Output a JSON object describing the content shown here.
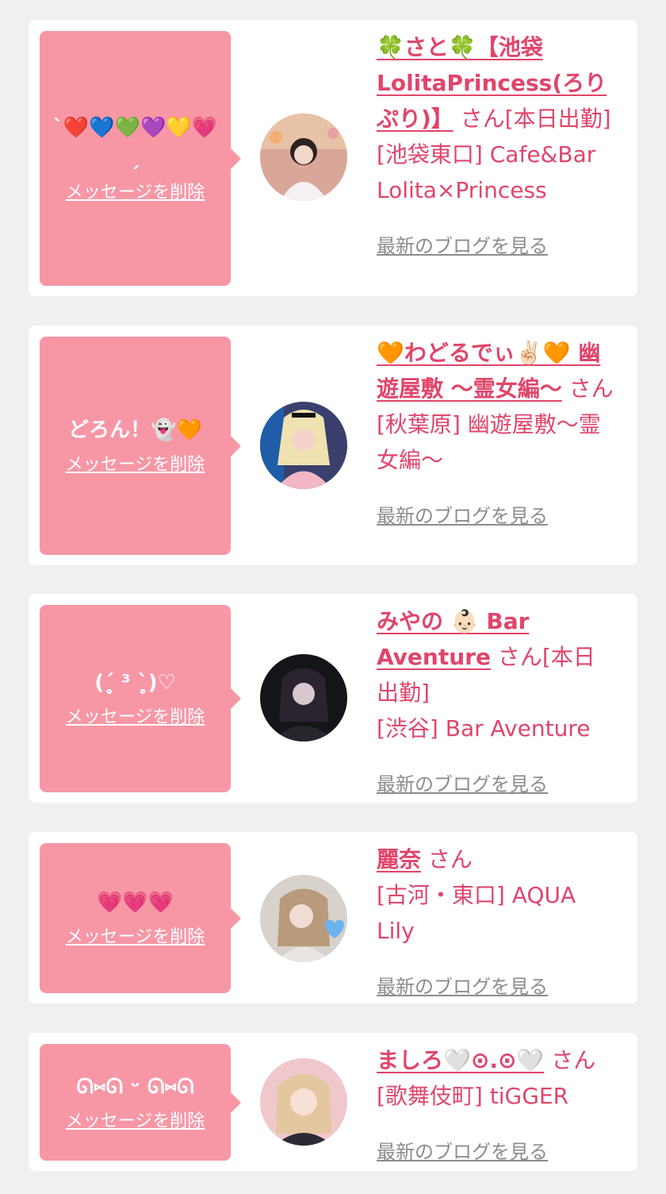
{
  "entries": [
    {
      "message": "ˋ❤️💙💚💜💛💗ˏ",
      "delete_label": "メッセージを削除",
      "name": "🍀さと🍀【池袋LolitaPrincess(ろりぷり)】",
      "suffix": "さん[本日出勤]",
      "shop": "[池袋東口] Cafe&Bar Lolita×Princess",
      "blog_label": "最新のブログを見る"
    },
    {
      "message": "どろん！👻🧡",
      "delete_label": "メッセージを削除",
      "name": "🧡わどるでぃ✌🏻🧡 幽遊屋敷 〜霊女編〜",
      "suffix": "さん",
      "shop": "[秋葉原] 幽遊屋敷〜霊女編〜",
      "blog_label": "最新のブログを見る"
    },
    {
      "message": "(ˊ̥̥̥̥̥ ³ ˋ̥̥̥̥̥)♡",
      "delete_label": "メッセージを削除",
      "name": "みやの 👶🏻 Bar Aventure",
      "suffix": "さん[本日出勤]",
      "shop": "[渋谷] Bar Aventure",
      "blog_label": "最新のブログを見る"
    },
    {
      "message": "💗💗💗",
      "delete_label": "メッセージを削除",
      "name": "麗奈",
      "suffix": "さん",
      "shop": "[古河・東口] AQUA Lily",
      "blog_label": "最新のブログを見る"
    },
    {
      "message": "ᘏ⑅ᘏ ᵕ ᘏ⑅ᘏ",
      "delete_label": "メッセージを削除",
      "name": "ましろ🤍⊙.⊙🤍",
      "suffix": "さん",
      "shop": "[歌舞伎町] tiGGER",
      "blog_label": "最新のブログを見る"
    }
  ],
  "colors": {
    "background": "#f0f0f1",
    "card": "#ffffff",
    "bubble": "#f797a6",
    "accent": "#e0456b",
    "link_gray": "#8c8c8c"
  }
}
